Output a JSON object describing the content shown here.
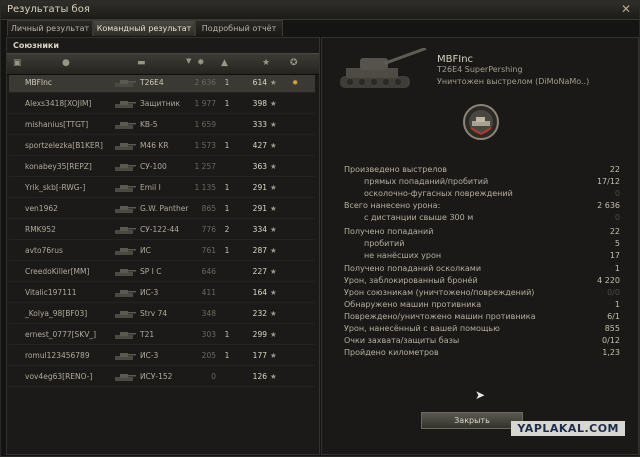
{
  "window": {
    "title": "Результаты боя",
    "close_symbol": "✕"
  },
  "tabs": [
    {
      "label": "Личный результат",
      "active": false
    },
    {
      "label": "Командный результат",
      "active": true
    },
    {
      "label": "Подробный отчёт",
      "active": false
    }
  ],
  "team": {
    "title": "Союзники",
    "players": [
      {
        "name": "MBFInc",
        "tank": "T26E4",
        "damage": "2 636",
        "kills": "1",
        "xp": "614",
        "me": true
      },
      {
        "name": "Alexs3418[XOJIM]",
        "tank": "Защитник",
        "damage": "1 977",
        "kills": "1",
        "xp": "398"
      },
      {
        "name": "mishanius[TTGT]",
        "tank": "KB-5",
        "damage": "1 659",
        "kills": "",
        "xp": "333"
      },
      {
        "name": "sportzelezka[B1KER]",
        "tank": "M46 KR",
        "damage": "1 573",
        "kills": "1",
        "xp": "427"
      },
      {
        "name": "konabey35[REPZ]",
        "tank": "СУ-100",
        "damage": "1 257",
        "kills": "",
        "xp": "363"
      },
      {
        "name": "Yrik_skb[-RWG-]",
        "tank": "Emil I",
        "damage": "1 135",
        "kills": "1",
        "xp": "291"
      },
      {
        "name": "ven1962",
        "tank": "G.W. Panther",
        "damage": "865",
        "kills": "1",
        "xp": "291"
      },
      {
        "name": "RMK952",
        "tank": "СУ-122-44",
        "damage": "776",
        "kills": "2",
        "xp": "334"
      },
      {
        "name": "avto76rus",
        "tank": "ИС",
        "damage": "761",
        "kills": "1",
        "xp": "287"
      },
      {
        "name": "CreedoKiller[MM]",
        "tank": "SP I C",
        "damage": "646",
        "kills": "",
        "xp": "227"
      },
      {
        "name": "Vitalic197111",
        "tank": "ИС-3",
        "damage": "411",
        "kills": "",
        "xp": "164"
      },
      {
        "name": "_Kolya_98[BF03]",
        "tank": "Strv 74",
        "damage": "348",
        "kills": "",
        "xp": "232"
      },
      {
        "name": "ernest_0777[SKV_]",
        "tank": "T21",
        "damage": "303",
        "kills": "1",
        "xp": "299"
      },
      {
        "name": "romul123456789",
        "tank": "ИС-3",
        "damage": "205",
        "kills": "1",
        "xp": "177"
      },
      {
        "name": "vov4eg63[RENO-]",
        "tank": "ИСУ-152",
        "damage": "0",
        "kills": "",
        "xp": "126"
      }
    ]
  },
  "detail": {
    "player": "MBFInc",
    "tank": "T26E4 SuperPershing",
    "destroyed_by": "Уничтожен выстрелом (DiMoNaMo..)",
    "stats": [
      {
        "label": "Произведено выстрелов",
        "value": "22",
        "sub": false
      },
      {
        "label": "прямых попаданий/пробитий",
        "value": "17/12",
        "sub": true
      },
      {
        "label": "осколочно-фугасных повреждений",
        "value": "0",
        "sub": true,
        "dim": true
      },
      {
        "label": "Всего нанесено урона:",
        "value": "2 636",
        "sub": false
      },
      {
        "label": "с дистанции свыше 300 м",
        "value": "0",
        "sub": true,
        "dim": true
      },
      {
        "label": "Получено попаданий",
        "value": "22",
        "sub": false
      },
      {
        "label": "пробитий",
        "value": "5",
        "sub": true
      },
      {
        "label": "не нанёсших урон",
        "value": "17",
        "sub": true
      },
      {
        "label": "Получено попаданий осколками",
        "value": "1",
        "sub": false
      },
      {
        "label": "Урон, заблокированный бронёй",
        "value": "4 220",
        "sub": false
      },
      {
        "label": "Урон союзникам (уничтожено/повреждений)",
        "value": "0/0",
        "sub": false,
        "dim": true
      },
      {
        "label": "Обнаружено машин противника",
        "value": "1",
        "sub": false
      },
      {
        "label": "Повреждено/уничтожено машин противника",
        "value": "6/1",
        "sub": false
      },
      {
        "label": "Урон, нанесённый с вашей помощью",
        "value": "855",
        "sub": false
      },
      {
        "label": "Очки захвата/защиты базы",
        "value": "0/12",
        "sub": false
      },
      {
        "label": "Пройдено километров",
        "value": "1,23",
        "sub": false
      }
    ],
    "close_label": "Закрыть"
  },
  "watermark": "YAPLAKAL.COM",
  "icons": {
    "medal": "✹",
    "star": "★",
    "cursor": "➤"
  }
}
